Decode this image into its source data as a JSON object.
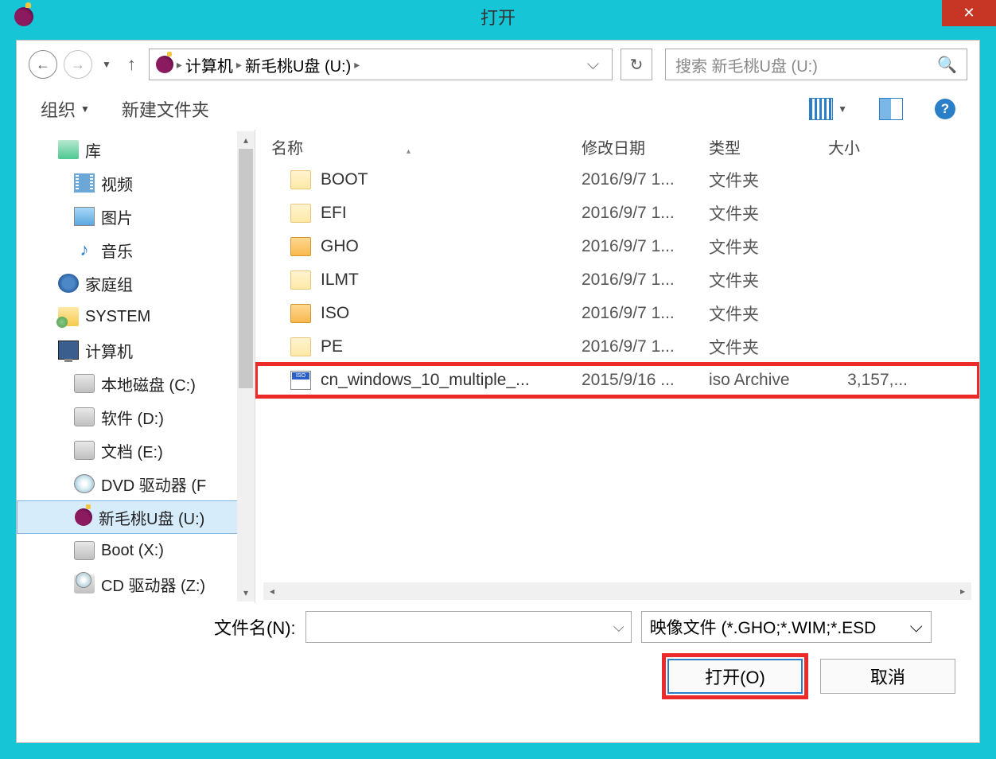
{
  "window": {
    "title": "打开"
  },
  "breadcrumb": {
    "seg1": "计算机",
    "seg2": "新毛桃U盘 (U:)"
  },
  "search": {
    "placeholder": "搜索 新毛桃U盘 (U:)"
  },
  "toolbar": {
    "organize": "组织",
    "new_folder": "新建文件夹"
  },
  "tree": {
    "library": "库",
    "video": "视频",
    "pictures": "图片",
    "music": "音乐",
    "homegroup": "家庭组",
    "system": "SYSTEM",
    "computer": "计算机",
    "drive_c": "本地磁盘 (C:)",
    "drive_d": "软件 (D:)",
    "drive_e": "文档 (E:)",
    "dvd_f": "DVD 驱动器 (F",
    "usb_u": "新毛桃U盘 (U:)",
    "boot_x": "Boot (X:)",
    "cd_z": "CD 驱动器 (Z:)"
  },
  "columns": {
    "name": "名称",
    "date": "修改日期",
    "type": "类型",
    "size": "大小"
  },
  "files": [
    {
      "name": "BOOT",
      "date": "2016/9/7 1...",
      "type": "文件夹",
      "size": ""
    },
    {
      "name": "EFI",
      "date": "2016/9/7 1...",
      "type": "文件夹",
      "size": ""
    },
    {
      "name": "GHO",
      "date": "2016/9/7 1...",
      "type": "文件夹",
      "size": ""
    },
    {
      "name": "ILMT",
      "date": "2016/9/7 1...",
      "type": "文件夹",
      "size": ""
    },
    {
      "name": "ISO",
      "date": "2016/9/7 1...",
      "type": "文件夹",
      "size": ""
    },
    {
      "name": "PE",
      "date": "2016/9/7 1...",
      "type": "文件夹",
      "size": ""
    },
    {
      "name": "cn_windows_10_multiple_...",
      "date": "2015/9/16 ...",
      "type": "iso Archive",
      "size": "3,157,..."
    }
  ],
  "bottom": {
    "filename_label": "文件名(N):",
    "filter": "映像文件 (*.GHO;*.WIM;*.ESD",
    "open": "打开(O)",
    "cancel": "取消"
  }
}
